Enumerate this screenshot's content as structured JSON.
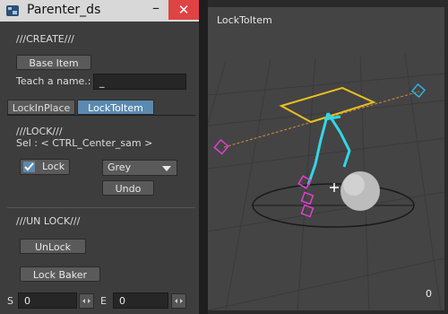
{
  "window": {
    "title": "Parenter_ds",
    "minimize": "–",
    "close": "✕"
  },
  "create": {
    "heading": "///CREATE///",
    "base_item": "Base Item",
    "teach_label": "Teach a name.:",
    "teach_value": "_"
  },
  "tabs": [
    {
      "label": "LockInPlace"
    },
    {
      "label": "LockToItem"
    }
  ],
  "lock": {
    "heading": "///LOCK///",
    "sel_label": "Sel : < CTRL_Center_sam >",
    "lock_label": "Lock",
    "lock_checked": true,
    "color_value": "Grey",
    "undo": "Undo"
  },
  "unlock": {
    "heading": "///UN LOCK///",
    "unlock": "UnLock",
    "lock_baker": "Lock Baker"
  },
  "range": {
    "s_label": "S",
    "s_value": "0",
    "e_label": "E",
    "e_value": "0"
  },
  "viewport": {
    "label": "LockToItem",
    "frame": "0"
  },
  "colors": {
    "accent": "#5b89b0",
    "close": "#e04343",
    "rig_cyan": "#33d6e6",
    "rig_pink": "#e040d0",
    "rig_yellow": "#e8c020"
  },
  "icons": [
    "app-icon",
    "check-icon",
    "chevron-down-icon",
    "spin-arrows-icon"
  ]
}
